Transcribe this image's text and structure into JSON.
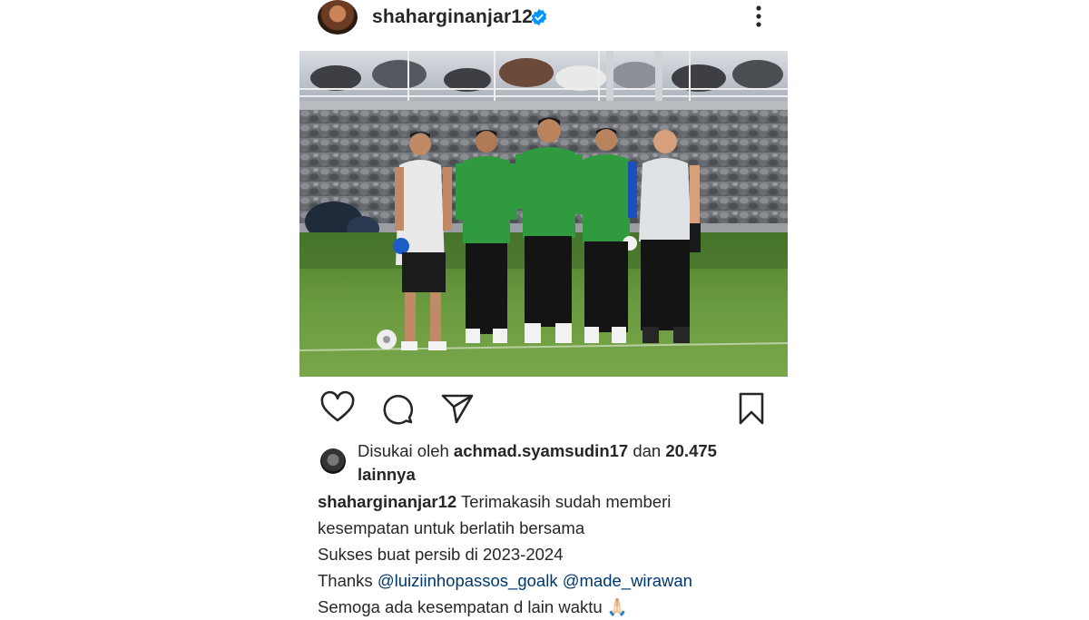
{
  "post": {
    "username": "shaharginanjar12",
    "verified": true
  },
  "icons": {
    "like": "heart-icon",
    "comment": "comment-icon",
    "share": "paper-plane-icon",
    "save": "bookmark-icon",
    "more": "more-vertical-icon",
    "verified": "verified-badge-icon"
  },
  "likes": {
    "prefix": "Disukai oleh",
    "user": "achmad.syamsudin17",
    "connector": "dan",
    "count": "20.475",
    "suffix": "lainnya"
  },
  "caption": {
    "username": "shaharginanjar12",
    "line1": "Terimakasih sudah memberi",
    "line2": "kesempatan untuk berlatih bersama",
    "line3": "Sukses buat persib di 2023-2024",
    "thanks": "Thanks",
    "mention1": "@luiziinhopassos_goalk",
    "mention2": "@made_wirawan",
    "line5": "Semoga ada kesempatan d lain waktu",
    "emoji": "🙏🏻"
  },
  "colors": {
    "verified": "#0095f6",
    "mention": "#00376b",
    "text": "#262626"
  }
}
